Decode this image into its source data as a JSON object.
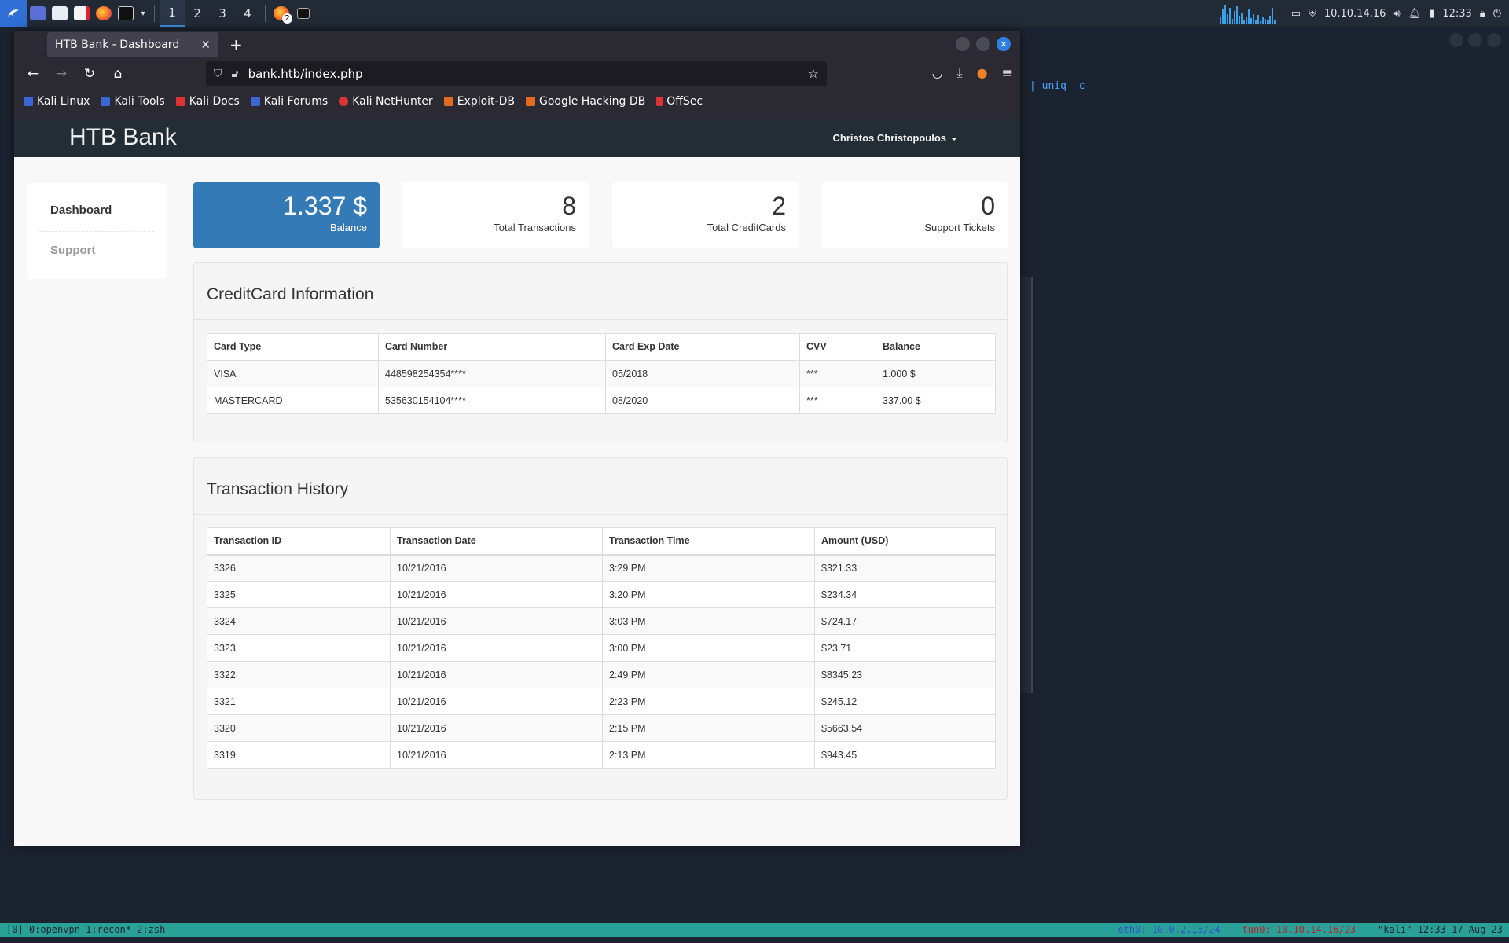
{
  "taskbar": {
    "workspaces": [
      "1",
      "2",
      "3",
      "4"
    ],
    "active_workspace": "1",
    "notification_badge": "2",
    "ip": "10.10.14.16",
    "clock": "12:33"
  },
  "terminal_bg": {
    "visible_text": "| uniq -c"
  },
  "tmux": {
    "windows": "[0] 0:openvpn  1:recon* 2:zsh-",
    "eth0_label": "eth0:",
    "eth0_value": "10.0.2.15/24",
    "tun0_label": "tun0:",
    "tun0_value": "10.10.14.16/23",
    "host_time": "\"kali\" 12:33 17-Aug-23"
  },
  "browser": {
    "tab_title": "HTB Bank - Dashboard",
    "url": "bank.htb/index.php",
    "bookmarks": [
      "Kali Linux",
      "Kali Tools",
      "Kali Docs",
      "Kali Forums",
      "Kali NetHunter",
      "Exploit-DB",
      "Google Hacking DB",
      "OffSec"
    ]
  },
  "site": {
    "brand": "HTB Bank",
    "user": "Christos Christopoulos",
    "nav": [
      "Dashboard",
      "Support"
    ],
    "stats": [
      {
        "value": "1.337 $",
        "label": "Balance"
      },
      {
        "value": "8",
        "label": "Total Transactions"
      },
      {
        "value": "2",
        "label": "Total CreditCards"
      },
      {
        "value": "0",
        "label": "Support Tickets"
      }
    ],
    "cc_panel": {
      "title": "CreditCard Information",
      "headers": [
        "Card Type",
        "Card Number",
        "Card Exp Date",
        "CVV",
        "Balance"
      ],
      "rows": [
        [
          "VISA",
          "448598254354****",
          "05/2018",
          "***",
          "1.000 $"
        ],
        [
          "MASTERCARD",
          "535630154104****",
          "08/2020",
          "***",
          "337.00 $"
        ]
      ]
    },
    "tx_panel": {
      "title": "Transaction History",
      "headers": [
        "Transaction ID",
        "Transaction Date",
        "Transaction Time",
        "Amount (USD)"
      ],
      "rows": [
        [
          "3326",
          "10/21/2016",
          "3:29 PM",
          "$321.33"
        ],
        [
          "3325",
          "10/21/2016",
          "3:20 PM",
          "$234.34"
        ],
        [
          "3324",
          "10/21/2016",
          "3:03 PM",
          "$724.17"
        ],
        [
          "3323",
          "10/21/2016",
          "3:00 PM",
          "$23.71"
        ],
        [
          "3322",
          "10/21/2016",
          "2:49 PM",
          "$8345.23"
        ],
        [
          "3321",
          "10/21/2016",
          "2:23 PM",
          "$245.12"
        ],
        [
          "3320",
          "10/21/2016",
          "2:15 PM",
          "$5663.54"
        ],
        [
          "3319",
          "10/21/2016",
          "2:13 PM",
          "$943.45"
        ]
      ]
    }
  }
}
